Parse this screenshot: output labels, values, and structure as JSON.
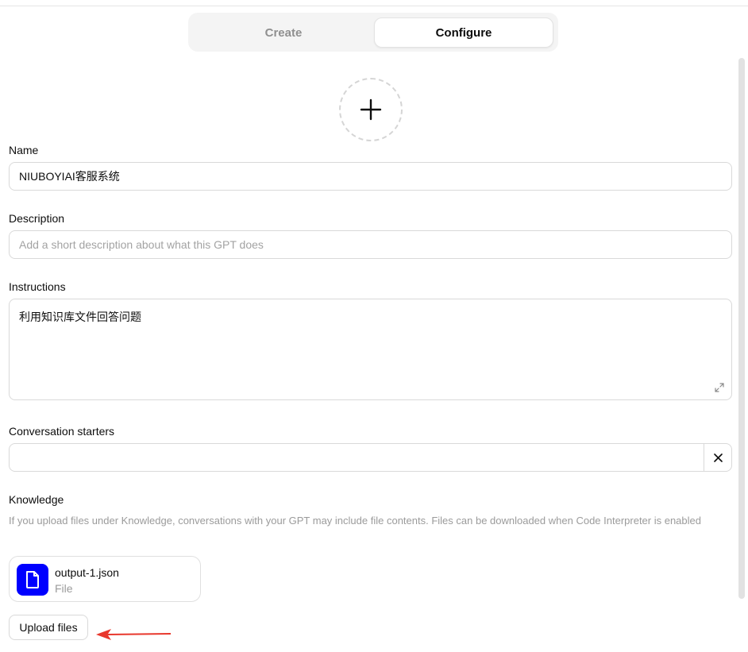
{
  "tabs": [
    {
      "label": "Create",
      "active": false
    },
    {
      "label": "Configure",
      "active": true
    }
  ],
  "avatar": {
    "icon": "plus-icon"
  },
  "name": {
    "label": "Name",
    "value": "NIUBOYIAI客服系统"
  },
  "description": {
    "label": "Description",
    "value": "",
    "placeholder": "Add a short description about what this GPT does"
  },
  "instructions": {
    "label": "Instructions",
    "value": "利用知识库文件回答问题",
    "icon": "expand-icon"
  },
  "conversation_starters": {
    "label": "Conversation starters",
    "value": "",
    "clear_icon": "close-icon"
  },
  "knowledge": {
    "label": "Knowledge",
    "note": "If you upload files under Knowledge, conversations with your GPT may include file contents. Files can be downloaded when Code Interpreter is enabled",
    "files": [
      {
        "name": "output-1.json",
        "type": "File",
        "icon": "file-icon",
        "icon_color": "#0000ff"
      }
    ],
    "upload_label": "Upload files"
  },
  "annotation": {
    "icon": "red-arrow-icon",
    "color": "#e8372c"
  }
}
